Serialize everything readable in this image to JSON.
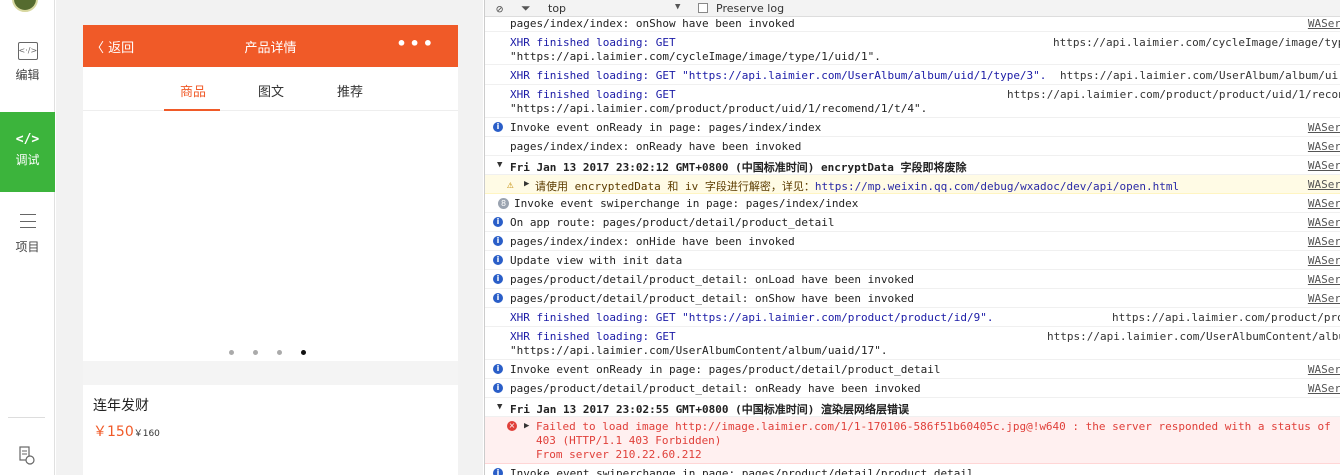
{
  "toolbar": {
    "items": [
      {
        "label": "编辑",
        "icon": "edit-code-icon"
      },
      {
        "label": "调试",
        "icon": "code-brackets-icon",
        "active": true
      },
      {
        "label": "项目",
        "icon": "list-icon"
      }
    ],
    "edit_glyph": "<·/>",
    "code_glyph": "</>",
    "accent_color": "#3cb43c"
  },
  "phone": {
    "nav_back": "〈 返回",
    "nav_title": "产品详情",
    "nav_more": "•••",
    "nav_color": "#f05a28",
    "tabs": [
      "商品",
      "图文",
      "推荐"
    ],
    "active_tab": "商品",
    "slides_total": 4,
    "slide_active": 4,
    "product_name": "连年发财",
    "price": "￥150",
    "old_price": "￥160"
  },
  "console": {
    "filter": {
      "context": "top",
      "preserve_log": "Preserve log"
    },
    "rows": [
      {
        "kind": "plain",
        "msg": "pages/index/index: onShow have been invoked",
        "src": "WASer"
      },
      {
        "kind": "xhr",
        "msg": "XHR finished loading: GET",
        "url": "https://api.laimier.com/cycleImage/image/typ",
        "cont": "\"https://api.laimier.com/cycleImage/image/type/1/uid/1\"."
      },
      {
        "kind": "xhr1",
        "msg": "XHR finished loading: GET \"https://api.laimier.com/UserAlbum/album/uid/1/type/3\".",
        "url": "https://api.laimier.com/UserAlbum/album/ui"
      },
      {
        "kind": "xhr",
        "msg": "XHR finished loading: GET",
        "url": "https://api.laimier.com/product/product/uid/1/recon",
        "cont": "\"https://api.laimier.com/product/product/uid/1/recomend/1/t/4\"."
      },
      {
        "kind": "info",
        "msg": "Invoke event onReady in page: pages/index/index",
        "src": "WASer"
      },
      {
        "kind": "plain",
        "msg": "pages/index/index: onReady have been invoked",
        "src": "WASer"
      },
      {
        "kind": "group",
        "msg": "Fri Jan 13 2017 23:02:12 GMT+0800 (中国标准时间) encryptData 字段即将废除",
        "src": "WASer"
      },
      {
        "kind": "warn",
        "msg": "请使用 encryptedData 和 iv 字段进行解密，详见：",
        "link": "https://mp.weixin.qq.com/debug/wxadoc/dev/api/open.html",
        "src": "WASer"
      },
      {
        "kind": "count",
        "count": "8",
        "msg": "Invoke event swiperchange in page: pages/index/index",
        "src": "WASer"
      },
      {
        "kind": "info",
        "msg": "On app route: pages/product/detail/product_detail",
        "src": "WASer"
      },
      {
        "kind": "info",
        "msg": "pages/index/index: onHide have been invoked",
        "src": "WASer"
      },
      {
        "kind": "info",
        "msg": "Update view with init data",
        "src": "WASer"
      },
      {
        "kind": "info",
        "msg": "pages/product/detail/product_detail: onLoad have been invoked",
        "src": "WASer"
      },
      {
        "kind": "info",
        "msg": "pages/product/detail/product_detail: onShow have been invoked",
        "src": "WASer"
      },
      {
        "kind": "xhr1",
        "msg": "XHR finished loading: GET \"https://api.laimier.com/product/product/id/9\".",
        "url": "https://api.laimier.com/product/pro"
      },
      {
        "kind": "xhr",
        "msg": "XHR finished loading: GET",
        "url": "https://api.laimier.com/UserAlbumContent/albu",
        "cont": "\"https://api.laimier.com/UserAlbumContent/album/uaid/17\"."
      },
      {
        "kind": "info",
        "msg": "Invoke event onReady in page: pages/product/detail/product_detail",
        "src": "WASer"
      },
      {
        "kind": "info",
        "msg": "pages/product/detail/product_detail: onReady have been invoked",
        "src": "WASer"
      },
      {
        "kind": "group",
        "msg": "Fri Jan 13 2017 23:02:55 GMT+0800 (中国标准时间) 渲染层网络层错误",
        "src": ""
      },
      {
        "kind": "error",
        "msg": "Failed to load image http://image.laimier.com/1/1-170106-586f51b60405c.jpg@!w640 : the server responded with a status of",
        "cont1": "403 (HTTP/1.1 403 Forbidden)",
        "cont2": "From server 210.22.60.212",
        "src": ""
      },
      {
        "kind": "info",
        "msg": "Invoke event swiperchange in page: pages/product/detail/product_detail",
        "src": ""
      }
    ]
  }
}
